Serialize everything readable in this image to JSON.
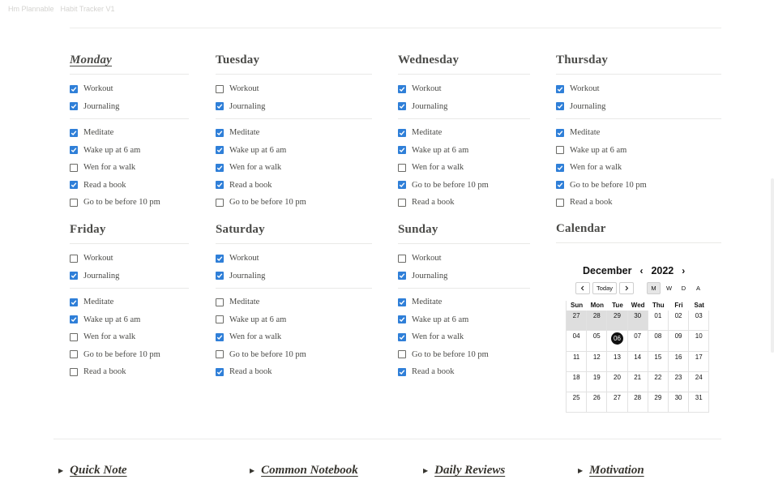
{
  "breadcrumb": [
    "Hm Plannable",
    "Habit Tracker V1"
  ],
  "days": [
    {
      "name": "Monday",
      "active": true,
      "top": [
        [
          "Workout",
          true
        ],
        [
          "Journaling",
          true
        ]
      ],
      "bottom": [
        [
          "Meditate",
          true
        ],
        [
          "Wake up at 6 am",
          true
        ],
        [
          "Wen for a walk",
          false
        ],
        [
          "Read a book",
          true
        ],
        [
          "Go to be before 10 pm",
          false
        ]
      ]
    },
    {
      "name": "Tuesday",
      "active": false,
      "top": [
        [
          "Workout",
          false
        ],
        [
          "Journaling",
          true
        ]
      ],
      "bottom": [
        [
          "Meditate",
          true
        ],
        [
          "Wake up at 6 am",
          true
        ],
        [
          "Wen for a walk",
          true
        ],
        [
          "Read a book",
          true
        ],
        [
          "Go to be before 10 pm",
          false
        ]
      ]
    },
    {
      "name": "Wednesday",
      "active": false,
      "top": [
        [
          "Workout",
          true
        ],
        [
          "Journaling",
          true
        ]
      ],
      "bottom": [
        [
          "Meditate",
          true
        ],
        [
          "Wake up at 6 am",
          true
        ],
        [
          "Wen for a walk",
          false
        ],
        [
          "Go to be before 10 pm",
          true
        ],
        [
          "Read a book",
          false
        ]
      ]
    },
    {
      "name": "Thursday",
      "active": false,
      "top": [
        [
          "Workout",
          true
        ],
        [
          "Journaling",
          true
        ]
      ],
      "bottom": [
        [
          "Meditate",
          true
        ],
        [
          "Wake up at 6 am",
          false
        ],
        [
          "Wen for a walk",
          true
        ],
        [
          "Go to be before 10 pm",
          true
        ],
        [
          "Read a book",
          false
        ]
      ]
    },
    {
      "name": "Friday",
      "active": false,
      "top": [
        [
          "Workout",
          false
        ],
        [
          "Journaling",
          true
        ]
      ],
      "bottom": [
        [
          "Meditate",
          true
        ],
        [
          "Wake up at 6 am",
          true
        ],
        [
          "Wen for a walk",
          false
        ],
        [
          "Go to be before 10 pm",
          false
        ],
        [
          "Read a book",
          false
        ]
      ]
    },
    {
      "name": "Saturday",
      "active": false,
      "top": [
        [
          "Workout",
          true
        ],
        [
          "Journaling",
          true
        ]
      ],
      "bottom": [
        [
          "Meditate",
          false
        ],
        [
          "Wake up at 6 am",
          false
        ],
        [
          "Wen for a walk",
          true
        ],
        [
          "Go to be before 10 pm",
          false
        ],
        [
          "Read a book",
          true
        ]
      ]
    },
    {
      "name": "Sunday",
      "active": false,
      "top": [
        [
          "Workout",
          false
        ],
        [
          "Journaling",
          true
        ]
      ],
      "bottom": [
        [
          "Meditate",
          true
        ],
        [
          "Wake up at 6 am",
          true
        ],
        [
          "Wen for a walk",
          true
        ],
        [
          "Go to be before 10 pm",
          false
        ],
        [
          "Read a book",
          true
        ]
      ]
    }
  ],
  "calendar": {
    "title": "Calendar",
    "month": "December",
    "year": "2022",
    "prev": "‹",
    "next": "›",
    "today": "Today",
    "views": [
      "M",
      "W",
      "D",
      "A"
    ],
    "dow": [
      "Sun",
      "Mon",
      "Tue",
      "Wed",
      "Thu",
      "Fri",
      "Sat"
    ],
    "weeks": [
      [
        "27",
        "28",
        "29",
        "30",
        "01",
        "02",
        "03"
      ],
      [
        "04",
        "05",
        "06",
        "07",
        "08",
        "09",
        "10"
      ],
      [
        "11",
        "12",
        "13",
        "14",
        "15",
        "16",
        "17"
      ],
      [
        "18",
        "19",
        "20",
        "21",
        "22",
        "23",
        "24"
      ],
      [
        "25",
        "26",
        "27",
        "28",
        "29",
        "30",
        "31"
      ]
    ],
    "outside": [
      [
        0,
        0
      ],
      [
        0,
        1
      ],
      [
        0,
        2
      ],
      [
        0,
        3
      ]
    ],
    "today_cell": [
      1,
      2
    ]
  },
  "toggles": [
    "Quick Note",
    "Common Notebook",
    "Daily Reviews",
    "Motivation"
  ],
  "colors": {
    "check": "#2f7fd8",
    "text": "#37352f"
  }
}
